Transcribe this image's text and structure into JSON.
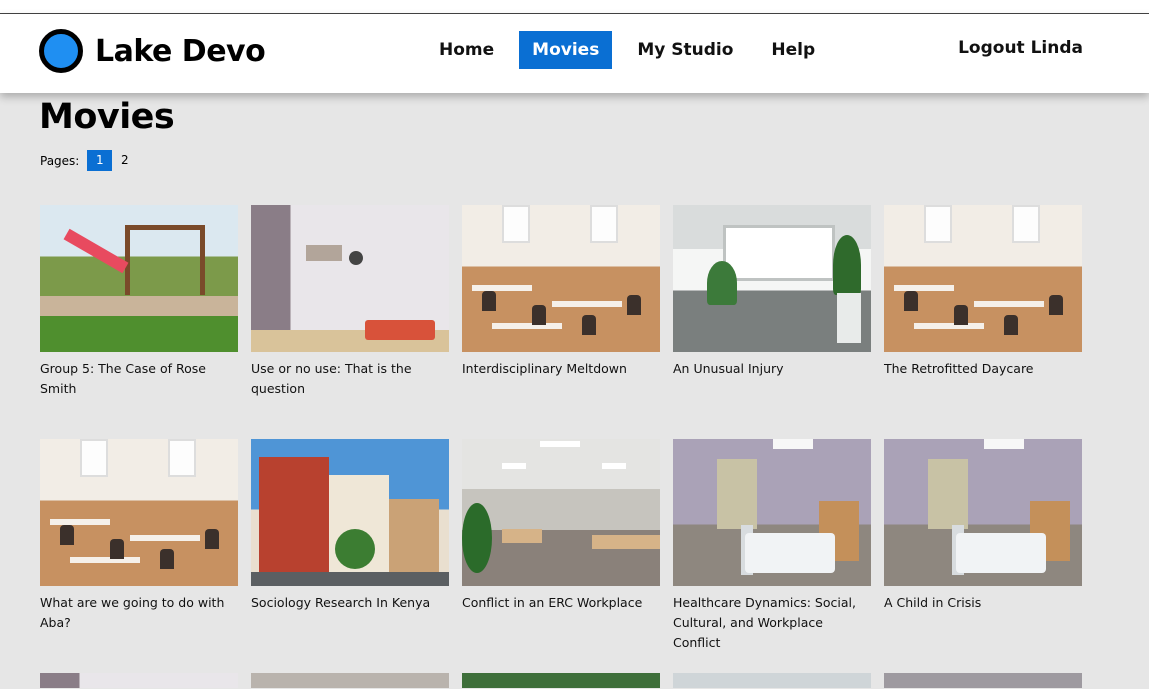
{
  "app": {
    "name": "Lake Devo"
  },
  "nav": {
    "items": [
      {
        "label": "Home",
        "active": false
      },
      {
        "label": "Movies",
        "active": true
      },
      {
        "label": "My Studio",
        "active": false
      },
      {
        "label": "Help",
        "active": false
      }
    ],
    "logout_label": "Logout Linda"
  },
  "page": {
    "title": "Movies",
    "pager_label": "Pages:",
    "pages": [
      "1",
      "2"
    ],
    "current_page": "1"
  },
  "movies": [
    {
      "title": "Group 5: The Case of Rose Smith",
      "thumb": "playground"
    },
    {
      "title": "Use or no use: That is the question",
      "thumb": "clinic"
    },
    {
      "title": "Interdisciplinary Meltdown",
      "thumb": "classroom"
    },
    {
      "title": "An Unusual Injury",
      "thumb": "room"
    },
    {
      "title": "The Retrofitted Daycare",
      "thumb": "classroom"
    },
    {
      "title": "What are we going to do with Aba?",
      "thumb": "classroom"
    },
    {
      "title": "Sociology Research In Kenya",
      "thumb": "street"
    },
    {
      "title": "Conflict in an ERC Workplace",
      "thumb": "office"
    },
    {
      "title": "Healthcare Dynamics: Social, Cultural, and Workplace Conflict",
      "thumb": "hospital"
    },
    {
      "title": "A Child in Crisis",
      "thumb": "hospital"
    }
  ],
  "colors": {
    "accent": "#0a6fd3",
    "logo": "#1f8ff2",
    "content_bg": "#e6e6e6"
  }
}
